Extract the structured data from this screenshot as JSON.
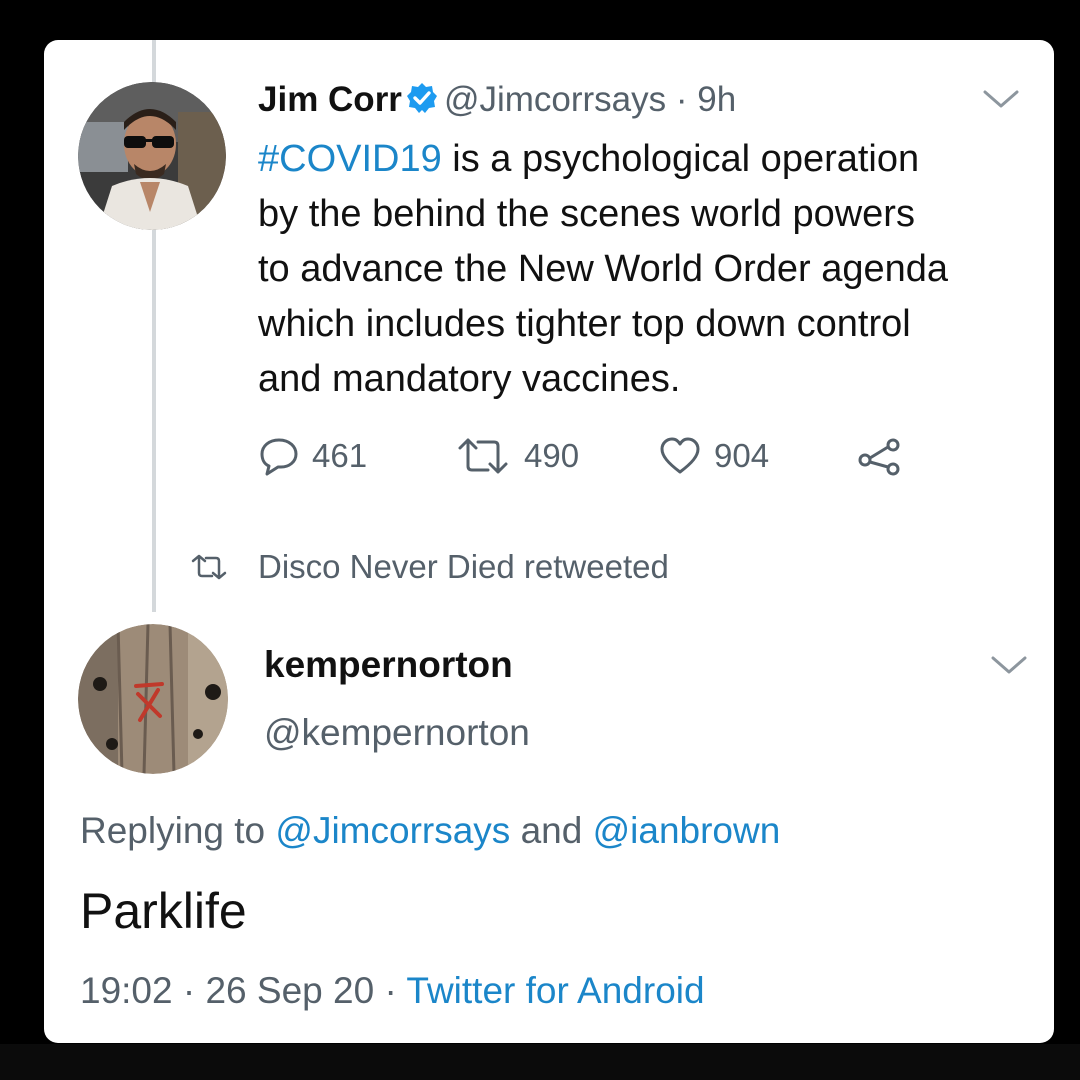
{
  "colors": {
    "background": "#000000",
    "card": "#ffffff",
    "text": "#111111",
    "secondary": "#55606a",
    "link": "#1b86c9",
    "thread_line": "#d4d8db"
  },
  "tweet": {
    "author_name": "Jim Corr",
    "verified": true,
    "handle": "@Jimcorrsays",
    "separator": "·",
    "time": "9h",
    "text_lines": [
      {
        "hashtag": "#COVID19",
        "rest": " is a psychological operation"
      },
      {
        "hashtag": "",
        "rest": "by the behind the scenes world powers"
      },
      {
        "hashtag": "",
        "rest": "to advance the New World Order agenda"
      },
      {
        "hashtag": "",
        "rest": "which includes tighter top down control"
      },
      {
        "hashtag": "",
        "rest": "and mandatory vaccines."
      }
    ],
    "actions": {
      "replies": "461",
      "retweets": "490",
      "likes": "904"
    },
    "icons": {
      "reply": "reply-icon",
      "retweet": "retweet-icon",
      "like": "heart-icon",
      "share": "share-icon",
      "menu": "chevron-down-icon"
    }
  },
  "retweet_context": {
    "text": "Disco Never Died retweeted",
    "icon": "retweet-icon"
  },
  "reply": {
    "author_name": "kempernorton",
    "handle": "@kempernorton",
    "replying_prefix": "Replying to ",
    "mention_1": "@Jimcorrsays",
    "conjunction": " and ",
    "mention_2": "@ianbrown",
    "body": "Parklife",
    "timestamp": "19:02 · 26 Sep 20 · ",
    "client": "Twitter for Android"
  }
}
